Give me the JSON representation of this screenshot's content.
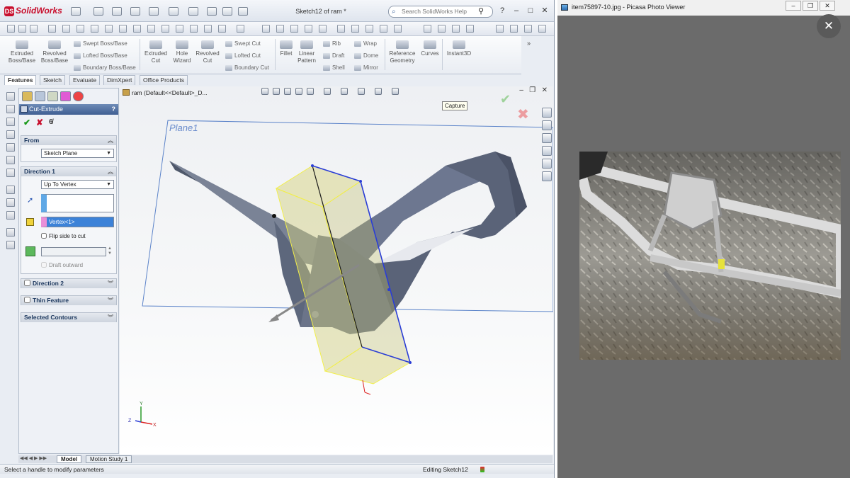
{
  "solidworks": {
    "app_name": "SolidWorks",
    "document_title": "Sketch12 of ram *",
    "search_placeholder": "Search SolidWorks Help",
    "ribbon": {
      "extruded_boss": "Extruded Boss/Base",
      "revolved_boss": "Revolved Boss/Base",
      "swept_boss": "Swept Boss/Base",
      "lofted_boss": "Lofted Boss/Base",
      "boundary_boss": "Boundary Boss/Base",
      "extruded_cut": "Extruded Cut",
      "hole_wizard": "Hole Wizard",
      "revolved_cut": "Revolved Cut",
      "swept_cut": "Swept Cut",
      "lofted_cut": "Lofted Cut",
      "boundary_cut": "Boundary Cut",
      "fillet": "Fillet",
      "linear_pattern": "Linear Pattern",
      "rib": "Rib",
      "draft": "Draft",
      "shell": "Shell",
      "wrap": "Wrap",
      "dome": "Dome",
      "mirror": "Mirror",
      "reference_geometry": "Reference Geometry",
      "curves": "Curves",
      "instant3d": "Instant3D"
    },
    "tabs": [
      "Features",
      "Sketch",
      "Evaluate",
      "DimXpert",
      "Office Products"
    ],
    "property_manager": {
      "title": "Cut-Extrude",
      "help": "?",
      "from_label": "From",
      "from_value": "Sketch Plane",
      "direction1_label": "Direction 1",
      "direction1_value": "Up To Vertex",
      "vertex_value": "Vertex<1>",
      "flip_side_label": "Flip side to cut",
      "draft_outward_label": "Draft outward",
      "direction2_label": "Direction 2",
      "thin_feature_label": "Thin Feature",
      "selected_contours_label": "Selected Contours"
    },
    "viewport": {
      "tree_crumb": "ram  (Default<<Default>_D...",
      "plane_label": "Plane1",
      "tooltip": "Capture",
      "axis_x": "X",
      "axis_y": "Y",
      "axis_z": "Z"
    },
    "bottom_tabs": [
      "Model",
      "Motion Study 1"
    ],
    "status_left": "Select a handle to modify parameters",
    "status_right": "Editing Sketch12"
  },
  "picasa": {
    "title": "item75897-10.jpg - Picasa Photo Viewer",
    "close_icon_glyph": "✕"
  },
  "colors": {
    "sw_accent": "#3f5f92",
    "plane_line": "#5b83c9",
    "cut_preview_fill": "#d9d68a",
    "model_body": "#5b6479",
    "picasa_bg": "#6b6b6b"
  }
}
